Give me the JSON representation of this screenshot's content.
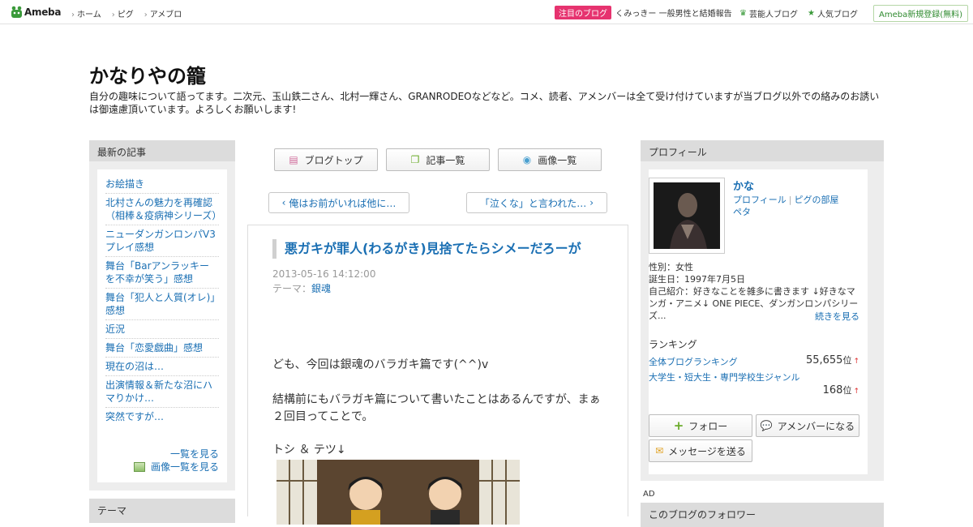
{
  "topbar": {
    "logo_text": "Ameba",
    "nav": [
      "ホーム",
      "ピグ",
      "アメブロ"
    ],
    "pickup_badge": "注目のブログ",
    "pickup_text": "くみっきー 一般男性と結婚報告",
    "celeb_link": "芸能人ブログ",
    "popular_link": "人気ブログ",
    "register": "Ameba新規登録(無料)"
  },
  "header": {
    "title": "かなりやの籠",
    "description": "自分の趣味について語ってます。二次元、玉山鉄二さん、北村一輝さん、GRANRODEOなどなど。コメ、読者、アメンバーは全て受け付けていますが当ブログ以外での絡みのお誘いは御遠慮頂いています。よろしくお願いします!"
  },
  "left": {
    "recent_heading": "最新の記事",
    "entries": [
      "お絵描き",
      "北村さんの魅力を再確認（相棒＆疫病神シリーズ）",
      "ニューダンガンロンパV3プレイ感想",
      "舞台「Barアンラッキーを不幸が笑う」感想",
      "舞台「犯人と人質(オレ)」感想",
      "近況",
      "舞台「恋愛戯曲」感想",
      "現在の沼は…",
      "出演情報＆新たな沼にハマりかけ…",
      "突然ですが…"
    ],
    "list_more": "一覧を見る",
    "image_list_more": "画像一覧を見る",
    "theme_heading": "テーマ"
  },
  "center": {
    "nav_buttons": [
      "ブログトップ",
      "記事一覧",
      "画像一覧"
    ],
    "prev": "俺はお前がいれば他に…",
    "next": "「泣くな」と言われた…",
    "article": {
      "title": "悪ガキが罪人(わるがき)見捨てたらシメーだろーが",
      "date": "2013-05-16 14:12:00",
      "theme_label": "テーマ：",
      "theme": "銀魂",
      "p1": "ども、今回は銀魂のバラガキ篇です(^^)v",
      "p2": "結構前にもバラガキ篇について書いたことはあるんですが、まぁ２回目ってことで。",
      "p3": "トシ ＆ テツ↓"
    }
  },
  "right": {
    "profile_heading": "プロフィール",
    "name": "かな",
    "link_profile": "プロフィール",
    "link_room": "ピグの部屋",
    "link_peta": "ペタ",
    "gender": "性別：女性",
    "birthday": "誕生日：1997年7月5日",
    "intro": "自己紹介：好きなことを雑多に書きます ↓好きなマンガ・アニメ↓ ONE PIECE、ダンガンロンパシリーズ...",
    "read_more": "続きを見る",
    "ranking_heading": "ランキング",
    "rank1_label": "全体ブログランキング",
    "rank1_value": "55,655",
    "rank2_label": "大学生・短大生・専門学校生ジャンル",
    "rank2_value": "168",
    "rank_unit": "位",
    "rank_arrow": "↑",
    "follow": "フォロー",
    "amember": "アメンバーになる",
    "message": "メッセージを送る",
    "ad_label": "AD",
    "follow_heading": "このブログのフォロワー"
  },
  "colors": {
    "link": "#1a6fb3",
    "pickup": "#e6336f",
    "ameba_green": "#3a9a3a"
  }
}
